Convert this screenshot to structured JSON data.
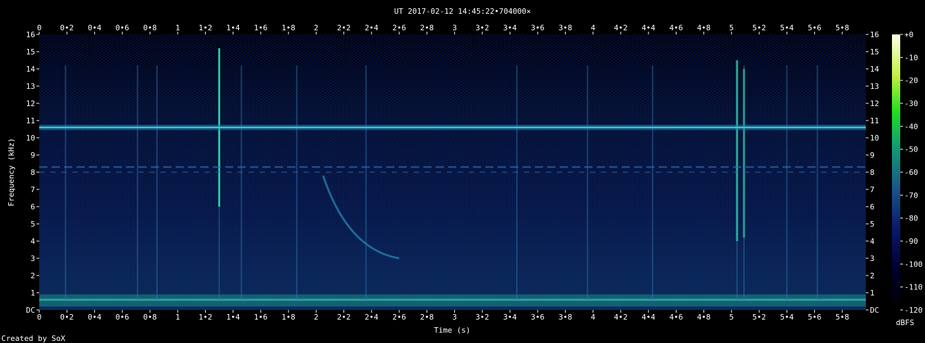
{
  "chart_data": {
    "type": "heatmap",
    "title": "UT 2017-02-12 14:45:22•704000×",
    "xlabel": "Time (s)",
    "ylabel": "Frequency (kHz)",
    "credit": "Created by SoX",
    "colorbar_label": "dBFS",
    "xlim": [
      0,
      5.97
    ],
    "ylim": [
      0,
      16
    ],
    "x_ticks": [
      "0",
      "0•2",
      "0•4",
      "0•6",
      "0•8",
      "1",
      "1•2",
      "1•4",
      "1•6",
      "1•8",
      "2",
      "2•2",
      "2•4",
      "2•6",
      "2•8",
      "3",
      "3•2",
      "3•4",
      "3•6",
      "3•8",
      "4",
      "4•2",
      "4•4",
      "4•6",
      "4•8",
      "5",
      "5•2",
      "5•4",
      "5•6",
      "5•8"
    ],
    "y_ticks": [
      "DC",
      "1",
      "2",
      "3",
      "4",
      "5",
      "6",
      "7",
      "8",
      "9",
      "10",
      "11",
      "12",
      "13",
      "14",
      "15",
      "16"
    ],
    "colorbar_ticks": [
      "+0",
      "-10",
      "-20",
      "-30",
      "-40",
      "-50",
      "-60",
      "-70",
      "-80",
      "-90",
      "-100",
      "-110",
      "-120"
    ],
    "colorbar_range": [
      -120,
      0
    ],
    "colors": {
      "background": "#000000",
      "low": "#000014",
      "mid": "#0a2a6e",
      "high": "#14c8a0",
      "peak": "#ffffff"
    },
    "features": {
      "band_khz": 10.6,
      "low_band_khz": [
        0.2,
        0.9
      ],
      "dashed_band_khz": 8.3,
      "dashed_band2_khz": 8.0,
      "vertical_spikes_s": [
        0.19,
        0.71,
        0.85,
        1.3,
        1.46,
        1.86,
        2.36,
        3.45,
        3.96,
        4.43,
        5.04,
        5.09,
        5.4,
        5.62
      ],
      "whistler_start": [
        2.05,
        7.8
      ],
      "whistler_end": [
        2.6,
        3.0
      ]
    }
  }
}
